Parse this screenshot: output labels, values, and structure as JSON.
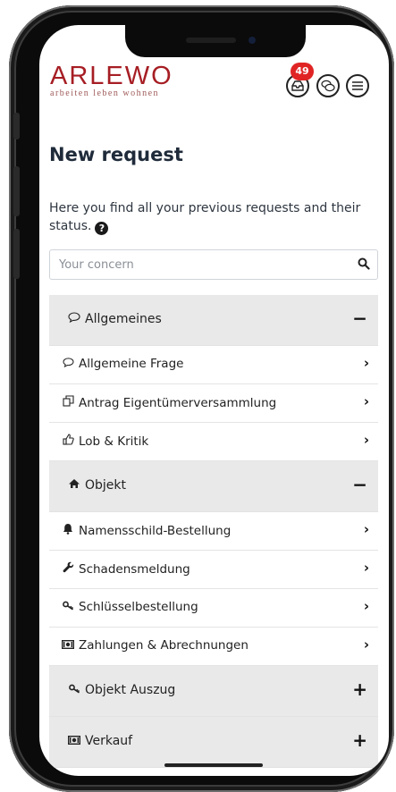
{
  "header": {
    "logo_main": "ARLEWO",
    "logo_sub": "arbeiten leben wohnen",
    "notification_count": "49"
  },
  "page": {
    "title": "New request",
    "intro": "Here you find all your previous requests and their status."
  },
  "search": {
    "placeholder": "Your concern"
  },
  "categories": [
    {
      "label": "Allgemeines",
      "icon": "speech-bubble-icon",
      "expanded": true,
      "items": [
        {
          "label": "Allgemeine Frage",
          "icon": "speech-bubble-icon"
        },
        {
          "label": "Antrag Eigentümerversammlung",
          "icon": "copy-icon"
        },
        {
          "label": "Lob & Kritik",
          "icon": "thumbs-up-icon"
        }
      ]
    },
    {
      "label": "Objekt",
      "icon": "home-icon",
      "expanded": true,
      "items": [
        {
          "label": "Namensschild-Bestellung",
          "icon": "bell-icon"
        },
        {
          "label": "Schadensmeldung",
          "icon": "wrench-icon"
        },
        {
          "label": "Schlüsselbestellung",
          "icon": "key-icon"
        },
        {
          "label": "Zahlungen & Abrechnungen",
          "icon": "money-icon"
        }
      ]
    },
    {
      "label": "Objekt Auszug",
      "icon": "key-icon",
      "expanded": false,
      "items": []
    },
    {
      "label": "Verkauf",
      "icon": "money-icon",
      "expanded": false,
      "items": []
    }
  ],
  "colors": {
    "brand": "#a61e24",
    "badge": "#e02424",
    "category_bg": "#e9e9e9"
  }
}
